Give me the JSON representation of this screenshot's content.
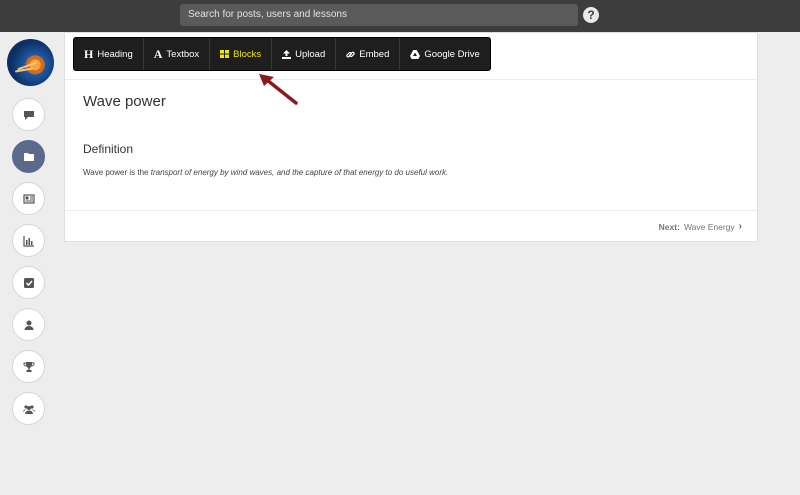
{
  "search": {
    "placeholder": "Search for posts, users and lessons"
  },
  "help": {
    "label": "?"
  },
  "sidebar": {
    "items": [
      {
        "name": "comments",
        "icon": "comment-icon"
      },
      {
        "name": "lessons",
        "icon": "folder-icon",
        "active": true
      },
      {
        "name": "news",
        "icon": "newspaper-icon"
      },
      {
        "name": "stats",
        "icon": "bar-chart-icon"
      },
      {
        "name": "tasks",
        "icon": "checkbox-icon"
      },
      {
        "name": "profile",
        "icon": "user-icon"
      },
      {
        "name": "awards",
        "icon": "trophy-icon"
      },
      {
        "name": "groups",
        "icon": "users-icon"
      }
    ]
  },
  "toolbar": {
    "items": [
      {
        "icon": "H",
        "label": "Heading"
      },
      {
        "icon": "A",
        "label": "Textbox"
      },
      {
        "icon": "blocks-icon",
        "label": "Blocks",
        "highlight": true
      },
      {
        "icon": "upload-icon",
        "label": "Upload"
      },
      {
        "icon": "link-icon",
        "label": "Embed"
      },
      {
        "icon": "drive-icon",
        "label": "Google Drive"
      }
    ],
    "highlight_color": "#f2e600"
  },
  "lesson": {
    "title": "Wave power",
    "section_heading": "Definition",
    "definition_prefix": "Wave power is the ",
    "definition_italic": "transport of energy by wind waves, and the capture of that energy to do useful work."
  },
  "footer": {
    "next_label": "Next:",
    "next_title": "Wave Energy",
    "next_chevron": "›"
  },
  "colors": {
    "topbar": "#3d3d3d",
    "active_sidebar": "#5b6a8a",
    "arrow": "#8b1a1a"
  }
}
